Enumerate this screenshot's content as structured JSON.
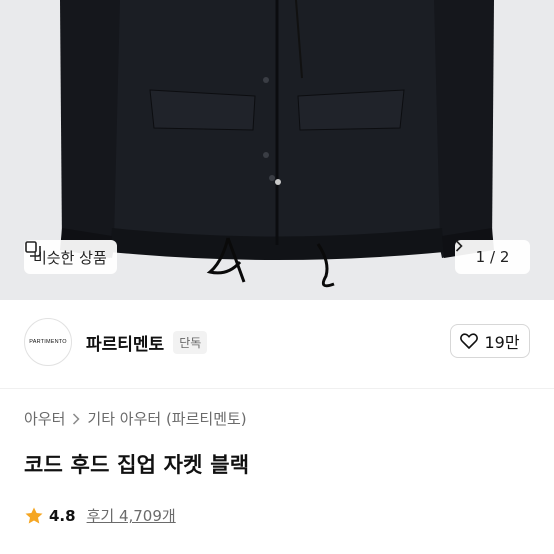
{
  "hero": {
    "similar_label": "비슷한 상품",
    "pager": {
      "current": "1",
      "separator": "/",
      "total": "2"
    }
  },
  "brand": {
    "logo_text": "PARTIMENTO",
    "name": "파르티멘토",
    "badge": "단독",
    "like_count": "19만"
  },
  "breadcrumb": {
    "root": "아우터",
    "child": "기타 아우터 (파르티멘토)"
  },
  "product": {
    "title": "코드 후드 집업 자켓 블랙",
    "rating": "4.8",
    "reviews_label": "후기 4,709개"
  },
  "colors": {
    "jacket": "#15171c",
    "star": "#f5a623"
  }
}
